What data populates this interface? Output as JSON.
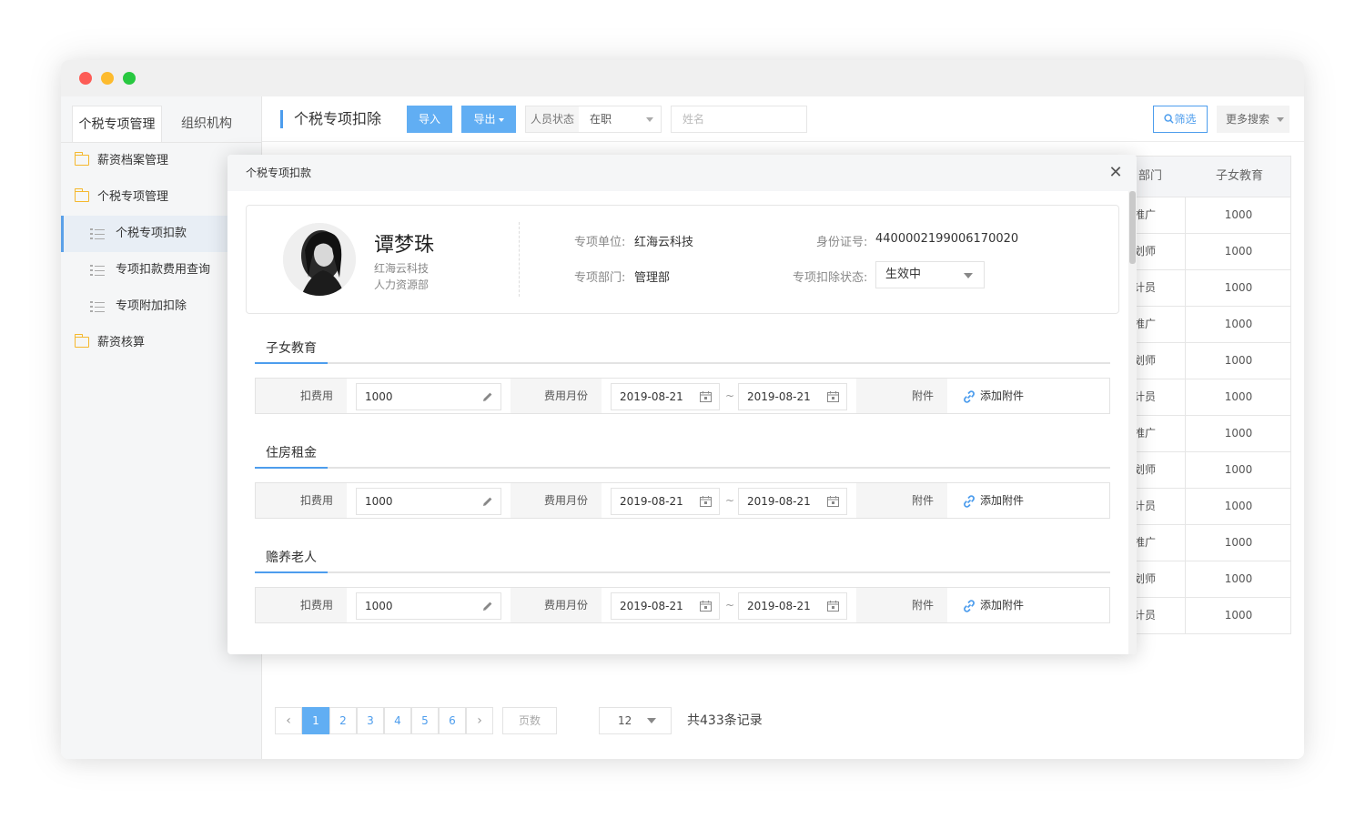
{
  "sidebar": {
    "tabs": [
      "个税专项管理",
      "组织机构"
    ],
    "items": [
      {
        "label": "薪资档案管理"
      },
      {
        "label": "个税专项管理"
      },
      {
        "label": "个税专项扣款"
      },
      {
        "label": "专项扣款费用查询"
      },
      {
        "label": "专项附加扣除"
      },
      {
        "label": "薪资核算"
      }
    ]
  },
  "toolbar": {
    "title": "个税专项扣除",
    "import_label": "导入",
    "export_label": "导出",
    "status_label": "人员状态",
    "status_value": "在职",
    "name_placeholder": "姓名",
    "filter_label": "筛选",
    "more_label": "更多搜索"
  },
  "table": {
    "headers": [
      "部门",
      "子女教育"
    ],
    "rows": [
      {
        "dept": "推广",
        "edu": "1000"
      },
      {
        "dept": "划师",
        "edu": "1000"
      },
      {
        "dept": "计员",
        "edu": "1000"
      },
      {
        "dept": "推广",
        "edu": "1000"
      },
      {
        "dept": "划师",
        "edu": "1000"
      },
      {
        "dept": "计员",
        "edu": "1000"
      },
      {
        "dept": "推广",
        "edu": "1000"
      },
      {
        "dept": "划师",
        "edu": "1000"
      },
      {
        "dept": "计员",
        "edu": "1000"
      },
      {
        "dept": "推广",
        "edu": "1000"
      },
      {
        "dept": "划师",
        "edu": "1000"
      },
      {
        "dept": "计员",
        "edu": "1000"
      }
    ]
  },
  "pagination": {
    "pages": [
      "1",
      "2",
      "3",
      "4",
      "5",
      "6"
    ],
    "current": "1",
    "jump_placeholder": "页数",
    "page_size": "12",
    "total": "共433条记录"
  },
  "modal": {
    "title": "个税专项扣款",
    "profile": {
      "name": "谭梦珠",
      "company": "红海云科技",
      "department": "人力资源部",
      "unit_label": "专项单位:",
      "unit_value": "红海云科技",
      "dept_label": "专项部门:",
      "dept_value": "管理部",
      "id_label": "身份证号:",
      "id_value": "4400002199006170020",
      "status_label": "专项扣除状态:",
      "status_value": "生效中"
    },
    "sections": [
      {
        "title": "子女教育",
        "fee_label": "扣费用",
        "fee_value": "1000",
        "month_label": "费用月份",
        "start": "2019-08-21",
        "end": "2019-08-21",
        "attach_label": "附件",
        "attach_action": "添加附件"
      },
      {
        "title": "住房租金",
        "fee_label": "扣费用",
        "fee_value": "1000",
        "month_label": "费用月份",
        "start": "2019-08-21",
        "end": "2019-08-21",
        "attach_label": "附件",
        "attach_action": "添加附件"
      },
      {
        "title": "赡养老人",
        "fee_label": "扣费用",
        "fee_value": "1000",
        "month_label": "费用月份",
        "start": "2019-08-21",
        "end": "2019-08-21",
        "attach_label": "附件",
        "attach_action": "添加附件"
      }
    ]
  },
  "colors": {
    "accent": "#4d9ded",
    "button": "#61aef3",
    "folder": "#f5b82e"
  }
}
